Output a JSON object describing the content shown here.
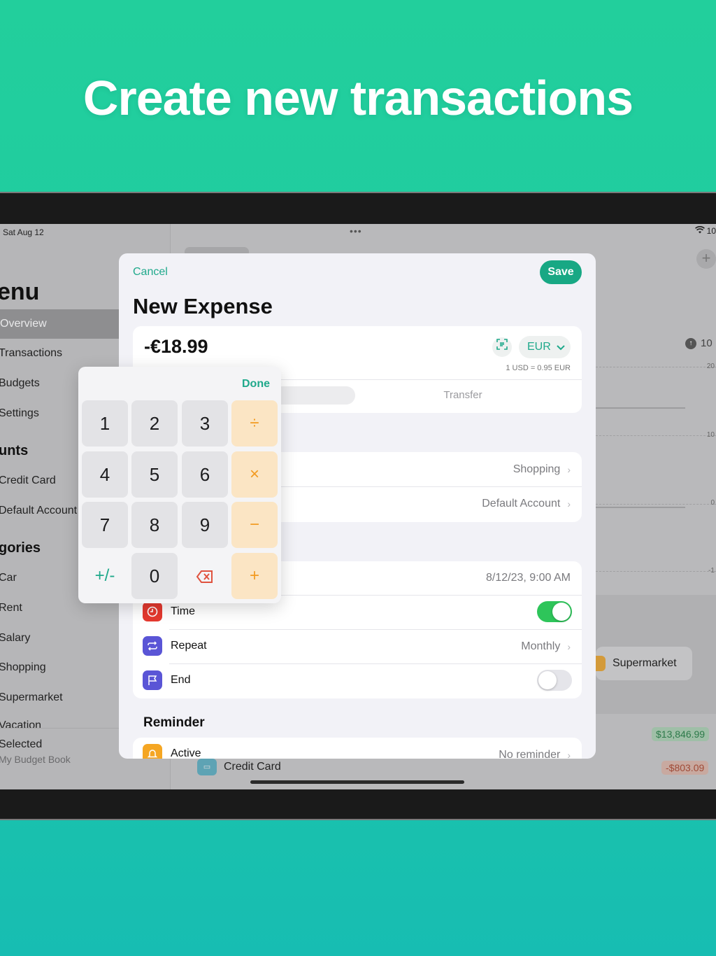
{
  "headline": "Create new transactions",
  "status": {
    "date": "Sat Aug 12",
    "dots": "•••",
    "battery": "10"
  },
  "sidebar": {
    "title": "enu",
    "items": [
      {
        "label": "Overview",
        "active": true
      },
      {
        "label": "Transactions"
      },
      {
        "label": "Budgets"
      },
      {
        "label": "Settings"
      }
    ],
    "accounts_title": "unts",
    "accounts": [
      "Credit Card",
      "Default Account"
    ],
    "categories_title": "gories",
    "categories": [
      "Car",
      "Rent",
      "Salary",
      "Shopping",
      "Supermarket",
      "Vacation"
    ],
    "footer": {
      "line1": "Selected",
      "line2": "My Budget Book"
    }
  },
  "background": {
    "plus": "+",
    "chart_value": "10",
    "grid_labels": [
      "20",
      "10",
      "0",
      "-1"
    ],
    "supermarket": "Supermarket",
    "amount_positive": "$13,846.99",
    "amount_negative": "-$803.09",
    "credit_card": "Credit Card"
  },
  "sheet": {
    "cancel": "Cancel",
    "save": "Save",
    "title": "New Expense",
    "amount": "-€18.99",
    "currency": "EUR",
    "rate": "1 USD = 0.95 EUR",
    "segment_transfer": "Transfer",
    "category_value": "Shopping",
    "account_value": "Default Account",
    "date_value": "8/12/23, 9:00 AM",
    "time_label": "Time",
    "time_on": true,
    "repeat_label": "Repeat",
    "repeat_value": "Monthly",
    "end_label": "End",
    "end_on": false,
    "reminder_title": "Reminder",
    "active_label": "Active",
    "reminder_value": "No reminder"
  },
  "keypad": {
    "done": "Done",
    "keys": [
      "1",
      "2",
      "3",
      "÷",
      "4",
      "5",
      "6",
      "×",
      "7",
      "8",
      "9",
      "−",
      "+/-",
      "0",
      "⌫",
      "+"
    ]
  },
  "colors": {
    "accent": "#1fa98b",
    "save": "#18a884",
    "toggle_on": "#2ec55a",
    "op_bg": "#fbe5c4",
    "op_fg": "#f29a21"
  }
}
